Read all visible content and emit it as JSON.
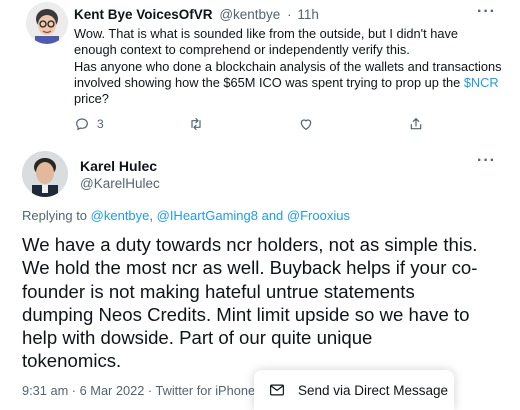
{
  "tweet1": {
    "author_name": "Kent Bye VoicesOfVR",
    "author_handle": "@kentbye",
    "separator": "·",
    "time": "11h",
    "text_line1": "Wow. That is what is sounded like from the outside, but I didn't have",
    "text_line2": "enough context to comprehend or independently verify this.",
    "text_line3": "Has anyone who done a blockchain analysis of the wallets and transactions",
    "text_line4_pre": "involved showing how the $65M ICO was spent trying to prop up the ",
    "text_cashtag": "$NCR",
    "text_line5": "price?",
    "reply_count": "3",
    "more_label": "···"
  },
  "tweet2": {
    "author_name": "Karel Hulec",
    "author_handle": "@KarelHulec",
    "more_label": "···",
    "replying_prefix": "Replying to ",
    "mention1": "@kentbye",
    "comma": ", ",
    "mention2": "@IHeartGaming8",
    "and_text": " and ",
    "mention3": "@Frooxius",
    "text_lines": [
      "We have a duty towards ncr holders, not as simple this.",
      "We hold the most ncr as well. Buyback helps if your co-",
      "founder is not making hateful untrue statements",
      "dumping Neos Credits. Mint limit upside so we have to",
      "help with dowside. Part of our quite unique",
      "tokenomics."
    ],
    "timestamp": "9:31 am · 6 Mar 2022 · Twitter for iPhone"
  },
  "dm_toast": {
    "label": "Send via Direct Message"
  },
  "colors": {
    "link": "#1d9bf0",
    "secondary_text": "#536471",
    "primary_text": "#0f1419"
  },
  "icons": {
    "reply": "reply-icon",
    "retweet": "retweet-icon",
    "like": "like-icon",
    "share": "share-icon",
    "envelope": "envelope-icon"
  }
}
